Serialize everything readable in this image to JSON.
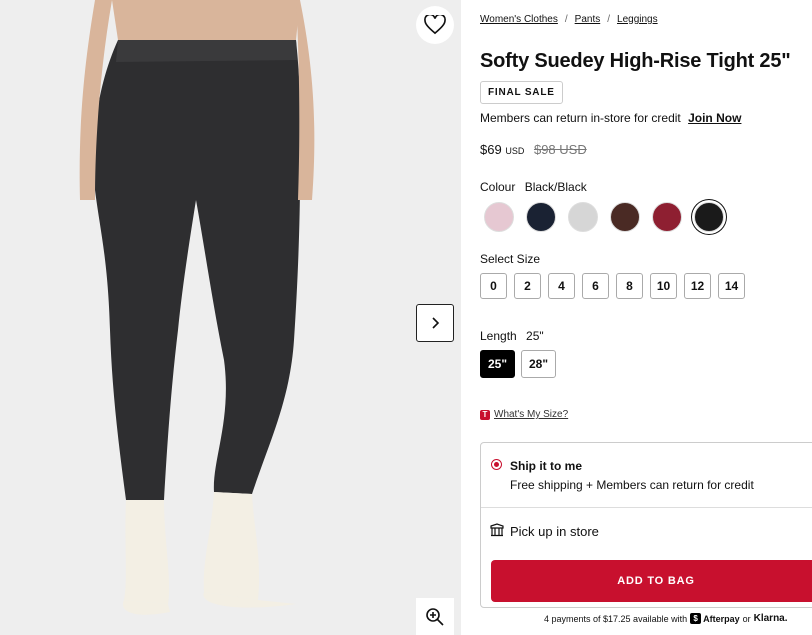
{
  "product_image": {
    "icons": [
      "heart-icon",
      "chevron-right-icon",
      "zoom-in-icon"
    ]
  },
  "breadcrumb": [
    "Women's Clothes",
    "Pants",
    "Leggings"
  ],
  "breadcrumb_sep": "/",
  "title": "Softy Suedey High-Rise Tight 25\"",
  "badge": "FINAL SALE",
  "members": {
    "text": "Members can return in-store for credit",
    "link": "Join Now"
  },
  "price": {
    "current": "$69",
    "currency": "USD",
    "was": "$98 USD"
  },
  "colour": {
    "label": "Colour",
    "value": "Black/Black",
    "swatches": [
      "#e6c8d2",
      "#1a2233",
      "#d6d6d6",
      "#4a2a24",
      "#8e1f31",
      "#1a1a1a"
    ],
    "selected_index": 5
  },
  "size": {
    "label": "Select Size",
    "options": [
      "0",
      "2",
      "4",
      "6",
      "8",
      "10",
      "12",
      "14"
    ]
  },
  "length": {
    "label": "Length",
    "value": "25\"",
    "options": [
      "25\"",
      "28\""
    ],
    "selected_index": 0
  },
  "whats_my_size": "What's My Size?",
  "shipping": {
    "ship_title": "Ship it to me",
    "ship_sub": "Free shipping + Members can return for credit",
    "pickup": "Pick up in store"
  },
  "add_to_bag": "ADD TO BAG",
  "installments": {
    "text": "4 payments of $17.25 available with",
    "afterpay": "Afterpay",
    "or": "or",
    "klarna": "Klarna."
  },
  "colors": {
    "accent": "#c8102e"
  }
}
